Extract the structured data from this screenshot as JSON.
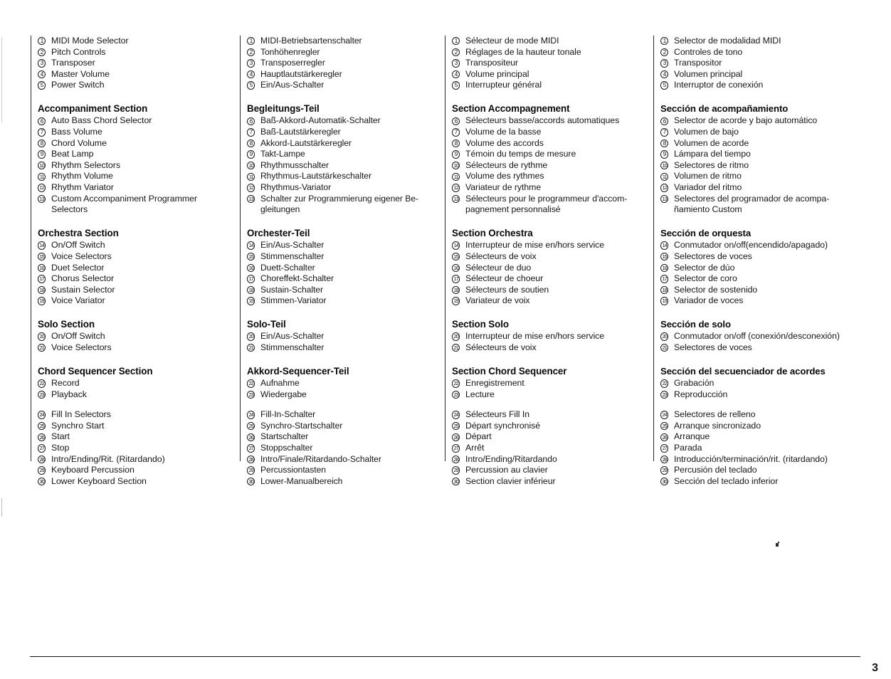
{
  "page": {
    "number": "3"
  },
  "columns": [
    {
      "lang": "en",
      "blocks": [
        {
          "heading": null,
          "items": [
            {
              "num": "1",
              "label": "MIDI Mode Selector"
            },
            {
              "num": "2",
              "label": "Pitch Controls"
            },
            {
              "num": "3",
              "label": "Transposer"
            },
            {
              "num": "4",
              "label": "Master Volume"
            },
            {
              "num": "5",
              "label": "Power Switch"
            }
          ]
        },
        {
          "heading": "Accompaniment Section",
          "items": [
            {
              "num": "6",
              "label": "Auto Bass Chord Selector"
            },
            {
              "num": "7",
              "label": "Bass Volume"
            },
            {
              "num": "8",
              "label": "Chord Volume"
            },
            {
              "num": "9",
              "label": "Beat Lamp"
            },
            {
              "num": "10",
              "label": "Rhythm Selectors"
            },
            {
              "num": "11",
              "label": "Rhythm Volume"
            },
            {
              "num": "12",
              "label": "Rhythm Variator"
            },
            {
              "num": "13",
              "label": "Custom Accompaniment Programmer\nSelectors"
            }
          ]
        },
        {
          "heading": "Orchestra Section",
          "items": [
            {
              "num": "14",
              "label": "On/Off Switch"
            },
            {
              "num": "15",
              "label": "Voice Selectors"
            },
            {
              "num": "16",
              "label": "Duet Selector"
            },
            {
              "num": "17",
              "label": "Chorus Selector"
            },
            {
              "num": "18",
              "label": "Sustain Selector"
            },
            {
              "num": "19",
              "label": "Voice Variator"
            }
          ]
        },
        {
          "heading": "Solo Section",
          "items": [
            {
              "num": "20",
              "label": "On/Off Switch"
            },
            {
              "num": "21",
              "label": "Voice Selectors"
            }
          ]
        },
        {
          "heading": "Chord Sequencer Section",
          "items": [
            {
              "num": "22",
              "label": "Record"
            },
            {
              "num": "23",
              "label": "Playback"
            }
          ]
        },
        {
          "heading": null,
          "items": [
            {
              "num": "24",
              "label": "Fill In Selectors"
            },
            {
              "num": "25",
              "label": "Synchro Start"
            },
            {
              "num": "26",
              "label": "Start"
            },
            {
              "num": "27",
              "label": "Stop"
            },
            {
              "num": "28",
              "label": "Intro/Ending/Rit. (Ritardando)"
            },
            {
              "num": "29",
              "label": "Keyboard Percussion"
            },
            {
              "num": "30",
              "label": "Lower Keyboard Section"
            }
          ]
        }
      ]
    },
    {
      "lang": "de",
      "blocks": [
        {
          "heading": null,
          "items": [
            {
              "num": "1",
              "label": "MIDI-Betriebsartenschalter"
            },
            {
              "num": "2",
              "label": "Tonhöhenregler"
            },
            {
              "num": "3",
              "label": "Transposerregler"
            },
            {
              "num": "4",
              "label": "Hauptlautstärkeregler"
            },
            {
              "num": "5",
              "label": "Ein/Aus-Schalter"
            }
          ]
        },
        {
          "heading": "Begleitungs-Teil",
          "items": [
            {
              "num": "6",
              "label": "Baß-Akkord-Automatik-Schalter"
            },
            {
              "num": "7",
              "label": "Baß-Lautstärkeregler"
            },
            {
              "num": "8",
              "label": "Akkord-Lautstärkeregler"
            },
            {
              "num": "9",
              "label": "Takt-Lampe"
            },
            {
              "num": "10",
              "label": "Rhythmusschalter"
            },
            {
              "num": "11",
              "label": "Rhythmus-Lautstärkeschalter"
            },
            {
              "num": "12",
              "label": "Rhythmus-Variator"
            },
            {
              "num": "13",
              "label": "Schalter zur Programmierung eigener Be-\ngleitungen"
            }
          ]
        },
        {
          "heading": "Orchester-Teil",
          "items": [
            {
              "num": "14",
              "label": "Ein/Aus-Schalter"
            },
            {
              "num": "15",
              "label": "Stimmenschalter"
            },
            {
              "num": "16",
              "label": "Duett-Schalter"
            },
            {
              "num": "17",
              "label": "Choreffekt-Schalter"
            },
            {
              "num": "18",
              "label": "Sustain-Schalter"
            },
            {
              "num": "19",
              "label": "Stimmen-Variator"
            }
          ]
        },
        {
          "heading": "Solo-Teil",
          "items": [
            {
              "num": "20",
              "label": "Ein/Aus-Schalter"
            },
            {
              "num": "21",
              "label": "Stimmenschalter"
            }
          ]
        },
        {
          "heading": "Akkord-Sequencer-Teil",
          "items": [
            {
              "num": "22",
              "label": "Aufnahme"
            },
            {
              "num": "23",
              "label": "Wiedergabe"
            }
          ]
        },
        {
          "heading": null,
          "items": [
            {
              "num": "24",
              "label": "Fill-In-Schalter"
            },
            {
              "num": "25",
              "label": "Synchro-Startschalter"
            },
            {
              "num": "26",
              "label": "Startschalter"
            },
            {
              "num": "27",
              "label": "Stoppschalter"
            },
            {
              "num": "28",
              "label": "Intro/Finale/Ritardando-Schalter"
            },
            {
              "num": "29",
              "label": "Percussiontasten"
            },
            {
              "num": "30",
              "label": "Lower-Manualbereich"
            }
          ]
        }
      ]
    },
    {
      "lang": "fr",
      "blocks": [
        {
          "heading": null,
          "items": [
            {
              "num": "1",
              "label": "Sélecteur de mode MIDI"
            },
            {
              "num": "2",
              "label": "Réglages de la hauteur tonale"
            },
            {
              "num": "3",
              "label": "Transpositeur"
            },
            {
              "num": "4",
              "label": "Volume principal"
            },
            {
              "num": "5",
              "label": "Interrupteur général"
            }
          ]
        },
        {
          "heading": "Section Accompagnement",
          "items": [
            {
              "num": "6",
              "label": "Sélecteurs basse/accords automatiques"
            },
            {
              "num": "7",
              "label": "Volume de la basse"
            },
            {
              "num": "8",
              "label": "Volume des accords"
            },
            {
              "num": "9",
              "label": "Témoin du temps de mesure"
            },
            {
              "num": "10",
              "label": "Sélecteurs de rythme"
            },
            {
              "num": "11",
              "label": "Volume des rythmes"
            },
            {
              "num": "12",
              "label": "Variateur de rythme"
            },
            {
              "num": "13",
              "label": "Sélecteurs pour le programmeur d'accom-\npagnement personnalisé"
            }
          ]
        },
        {
          "heading": "Section Orchestra",
          "items": [
            {
              "num": "14",
              "label": "Interrupteur de mise en/hors service"
            },
            {
              "num": "15",
              "label": "Sélecteurs de voix"
            },
            {
              "num": "16",
              "label": "Sélecteur de duo"
            },
            {
              "num": "17",
              "label": "Sélecteur de choeur"
            },
            {
              "num": "18",
              "label": "Sélecteurs de soutien"
            },
            {
              "num": "19",
              "label": "Variateur de voix"
            }
          ]
        },
        {
          "heading": "Section Solo",
          "items": [
            {
              "num": "20",
              "label": "Interrupteur de mise en/hors service"
            },
            {
              "num": "21",
              "label": "Sélecteurs de voix"
            }
          ]
        },
        {
          "heading": "Section Chord Sequencer",
          "items": [
            {
              "num": "22",
              "label": "Enregistrement"
            },
            {
              "num": "23",
              "label": "Lecture"
            }
          ]
        },
        {
          "heading": null,
          "items": [
            {
              "num": "24",
              "label": "Sélecteurs Fill In"
            },
            {
              "num": "25",
              "label": "Départ synchronisé"
            },
            {
              "num": "26",
              "label": "Départ"
            },
            {
              "num": "27",
              "label": "Arrêt"
            },
            {
              "num": "28",
              "label": "Intro/Ending/Ritardando"
            },
            {
              "num": "29",
              "label": "Percussion au clavier"
            },
            {
              "num": "30",
              "label": "Section clavier inférieur"
            }
          ]
        }
      ]
    },
    {
      "lang": "es",
      "blocks": [
        {
          "heading": null,
          "items": [
            {
              "num": "1",
              "label": "Selector de modalidad MIDI"
            },
            {
              "num": "2",
              "label": "Controles de tono"
            },
            {
              "num": "3",
              "label": "Transpositor"
            },
            {
              "num": "4",
              "label": "Volumen principal"
            },
            {
              "num": "5",
              "label": "Interruptor de conexión"
            }
          ]
        },
        {
          "heading": "Sección de acompañamiento",
          "items": [
            {
              "num": "6",
              "label": "Selector de acorde y bajo automático"
            },
            {
              "num": "7",
              "label": "Volumen de bajo"
            },
            {
              "num": "8",
              "label": "Volumen de acorde"
            },
            {
              "num": "9",
              "label": "Lámpara del tiempo"
            },
            {
              "num": "10",
              "label": "Selectores de ritmo"
            },
            {
              "num": "11",
              "label": "Volumen de ritmo"
            },
            {
              "num": "12",
              "label": "Variador del ritmo"
            },
            {
              "num": "13",
              "label": "Selectores del programador de acompa-\nñamiento Custom"
            }
          ]
        },
        {
          "heading": "Sección de orquesta",
          "items": [
            {
              "num": "14",
              "label": "Conmutador on/off(encendido/apagado)"
            },
            {
              "num": "15",
              "label": "Selectores de voces"
            },
            {
              "num": "16",
              "label": "Selector de dúo"
            },
            {
              "num": "17",
              "label": "Selector de coro"
            },
            {
              "num": "18",
              "label": "Selector de sostenido"
            },
            {
              "num": "19",
              "label": "Variador de voces"
            }
          ]
        },
        {
          "heading": "Sección de solo",
          "items": [
            {
              "num": "20",
              "label": "Conmutador on/off (conexión/desconexión)"
            },
            {
              "num": "21",
              "label": "Selectores de voces"
            }
          ]
        },
        {
          "heading": "Sección del secuenciador de acordes",
          "items": [
            {
              "num": "22",
              "label": "Grabación"
            },
            {
              "num": "23",
              "label": "Reproducción"
            }
          ]
        },
        {
          "heading": null,
          "items": [
            {
              "num": "24",
              "label": "Selectores de relleno"
            },
            {
              "num": "25",
              "label": "Arranque sincronizado"
            },
            {
              "num": "26",
              "label": "Arranque"
            },
            {
              "num": "27",
              "label": "Parada"
            },
            {
              "num": "28",
              "label": "Introducción/terminación/rit. (ritardando)"
            },
            {
              "num": "29",
              "label": "Percusión del teclado"
            },
            {
              "num": "30",
              "label": "Sección del teclado inferior"
            }
          ]
        }
      ]
    }
  ]
}
